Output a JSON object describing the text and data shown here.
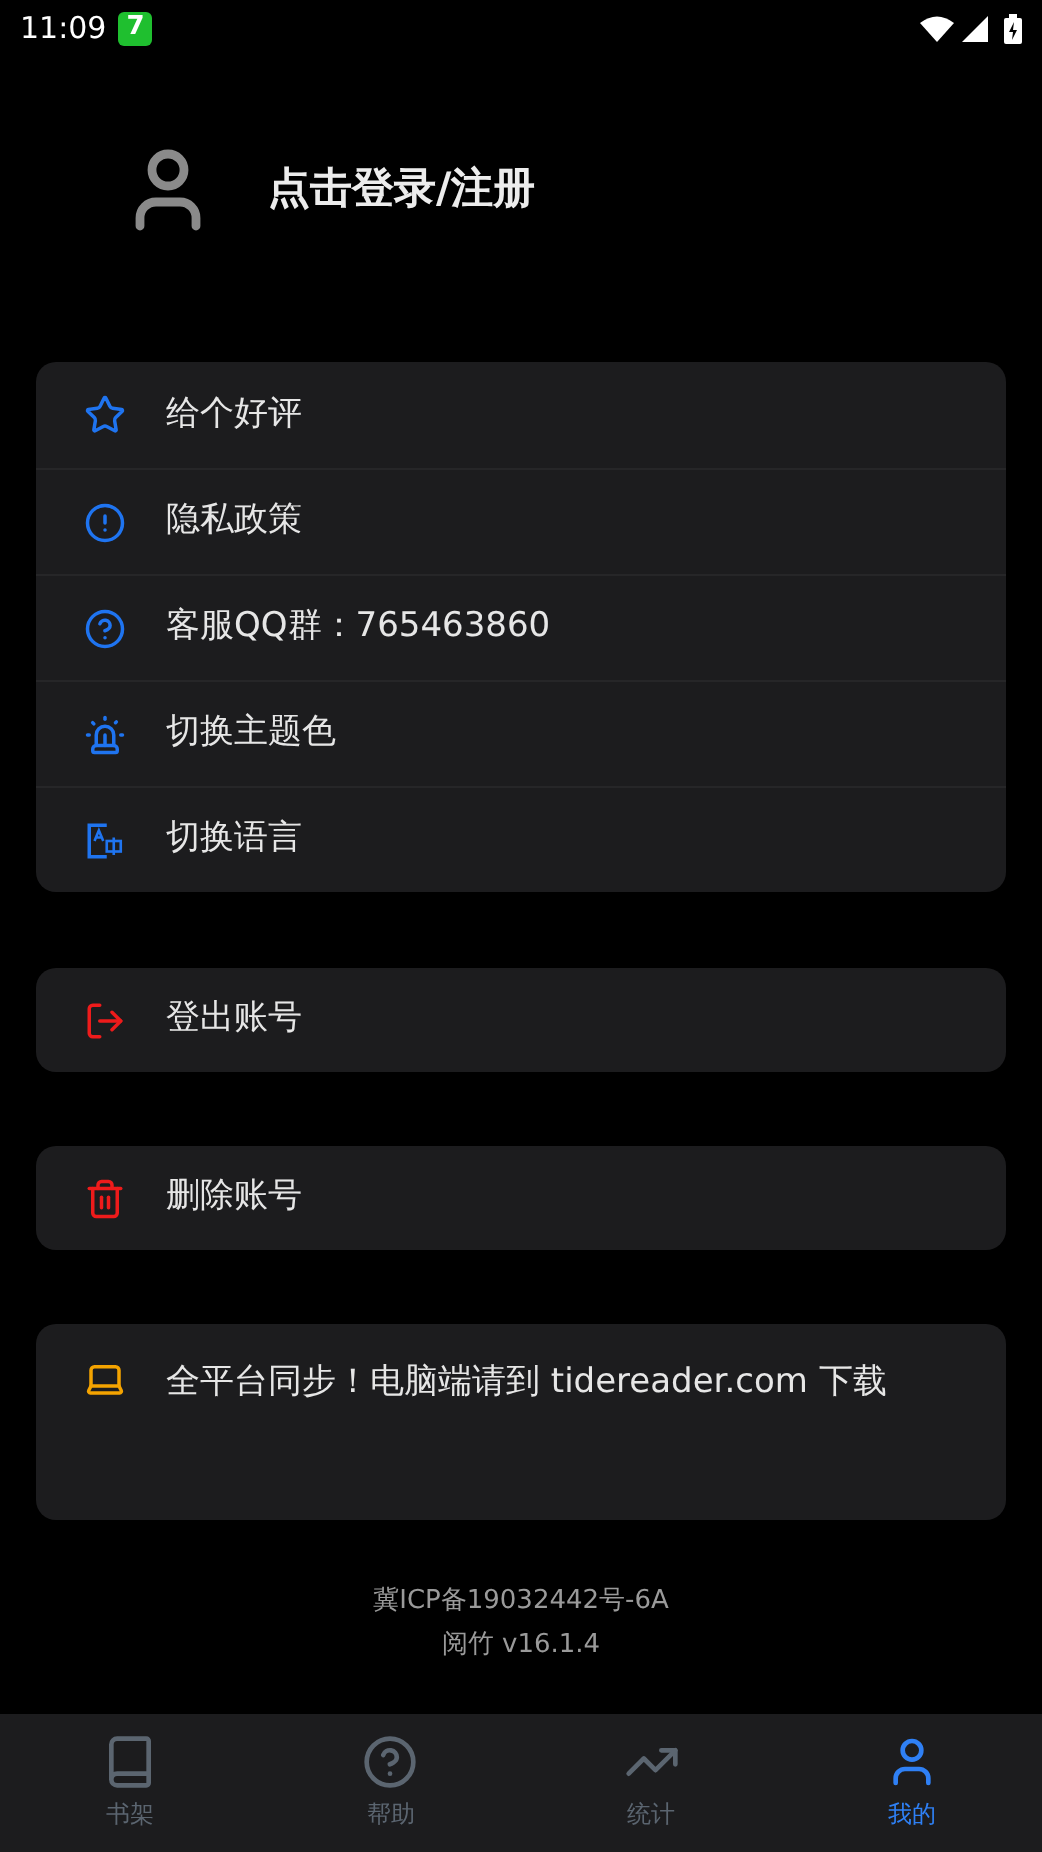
{
  "status_bar": {
    "time": "11:09",
    "badge": "7"
  },
  "login": {
    "label": "点击登录/注册"
  },
  "menu": [
    {
      "label": "给个好评"
    },
    {
      "label": "隐私政策"
    },
    {
      "label": "客服QQ群：765463860"
    },
    {
      "label": "切换主题色"
    },
    {
      "label": "切换语言"
    }
  ],
  "account_actions": [
    {
      "label": "登出账号"
    },
    {
      "label": "删除账号"
    }
  ],
  "promo": {
    "text": "全平台同步！电脑端请到 tidereader.com 下载"
  },
  "footer": {
    "icp": "冀ICP备19032442号-6A",
    "version": "阅竹 v16.1.4"
  },
  "bottom_nav": [
    {
      "label": "书架",
      "selected": false
    },
    {
      "label": "帮助",
      "selected": false
    },
    {
      "label": "统计",
      "selected": false
    },
    {
      "label": "我的",
      "selected": true
    }
  ]
}
